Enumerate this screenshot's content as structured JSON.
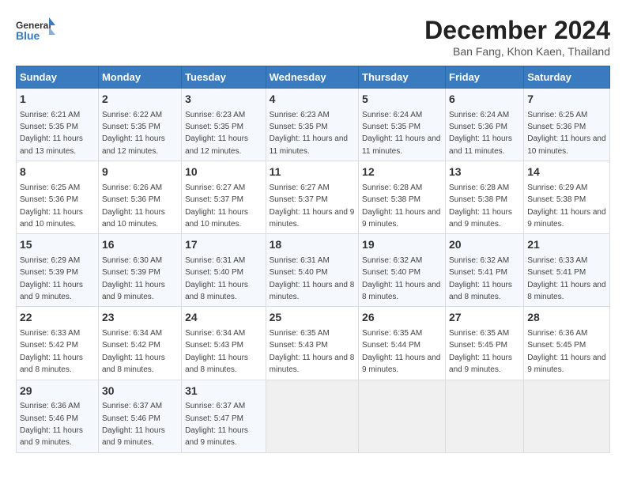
{
  "header": {
    "logo_line1": "General",
    "logo_line2": "Blue",
    "title": "December 2024",
    "subtitle": "Ban Fang, Khon Kaen, Thailand"
  },
  "days_of_week": [
    "Sunday",
    "Monday",
    "Tuesday",
    "Wednesday",
    "Thursday",
    "Friday",
    "Saturday"
  ],
  "weeks": [
    [
      {
        "day": "1",
        "rise": "6:21 AM",
        "set": "5:35 PM",
        "daylight": "11 hours and 13 minutes"
      },
      {
        "day": "2",
        "rise": "6:22 AM",
        "set": "5:35 PM",
        "daylight": "11 hours and 12 minutes"
      },
      {
        "day": "3",
        "rise": "6:23 AM",
        "set": "5:35 PM",
        "daylight": "11 hours and 12 minutes"
      },
      {
        "day": "4",
        "rise": "6:23 AM",
        "set": "5:35 PM",
        "daylight": "11 hours and 11 minutes"
      },
      {
        "day": "5",
        "rise": "6:24 AM",
        "set": "5:35 PM",
        "daylight": "11 hours and 11 minutes"
      },
      {
        "day": "6",
        "rise": "6:24 AM",
        "set": "5:36 PM",
        "daylight": "11 hours and 11 minutes"
      },
      {
        "day": "7",
        "rise": "6:25 AM",
        "set": "5:36 PM",
        "daylight": "11 hours and 10 minutes"
      }
    ],
    [
      {
        "day": "8",
        "rise": "6:25 AM",
        "set": "5:36 PM",
        "daylight": "11 hours and 10 minutes"
      },
      {
        "day": "9",
        "rise": "6:26 AM",
        "set": "5:36 PM",
        "daylight": "11 hours and 10 minutes"
      },
      {
        "day": "10",
        "rise": "6:27 AM",
        "set": "5:37 PM",
        "daylight": "11 hours and 10 minutes"
      },
      {
        "day": "11",
        "rise": "6:27 AM",
        "set": "5:37 PM",
        "daylight": "11 hours and 9 minutes"
      },
      {
        "day": "12",
        "rise": "6:28 AM",
        "set": "5:38 PM",
        "daylight": "11 hours and 9 minutes"
      },
      {
        "day": "13",
        "rise": "6:28 AM",
        "set": "5:38 PM",
        "daylight": "11 hours and 9 minutes"
      },
      {
        "day": "14",
        "rise": "6:29 AM",
        "set": "5:38 PM",
        "daylight": "11 hours and 9 minutes"
      }
    ],
    [
      {
        "day": "15",
        "rise": "6:29 AM",
        "set": "5:39 PM",
        "daylight": "11 hours and 9 minutes"
      },
      {
        "day": "16",
        "rise": "6:30 AM",
        "set": "5:39 PM",
        "daylight": "11 hours and 9 minutes"
      },
      {
        "day": "17",
        "rise": "6:31 AM",
        "set": "5:40 PM",
        "daylight": "11 hours and 8 minutes"
      },
      {
        "day": "18",
        "rise": "6:31 AM",
        "set": "5:40 PM",
        "daylight": "11 hours and 8 minutes"
      },
      {
        "day": "19",
        "rise": "6:32 AM",
        "set": "5:40 PM",
        "daylight": "11 hours and 8 minutes"
      },
      {
        "day": "20",
        "rise": "6:32 AM",
        "set": "5:41 PM",
        "daylight": "11 hours and 8 minutes"
      },
      {
        "day": "21",
        "rise": "6:33 AM",
        "set": "5:41 PM",
        "daylight": "11 hours and 8 minutes"
      }
    ],
    [
      {
        "day": "22",
        "rise": "6:33 AM",
        "set": "5:42 PM",
        "daylight": "11 hours and 8 minutes"
      },
      {
        "day": "23",
        "rise": "6:34 AM",
        "set": "5:42 PM",
        "daylight": "11 hours and 8 minutes"
      },
      {
        "day": "24",
        "rise": "6:34 AM",
        "set": "5:43 PM",
        "daylight": "11 hours and 8 minutes"
      },
      {
        "day": "25",
        "rise": "6:35 AM",
        "set": "5:43 PM",
        "daylight": "11 hours and 8 minutes"
      },
      {
        "day": "26",
        "rise": "6:35 AM",
        "set": "5:44 PM",
        "daylight": "11 hours and 9 minutes"
      },
      {
        "day": "27",
        "rise": "6:35 AM",
        "set": "5:45 PM",
        "daylight": "11 hours and 9 minutes"
      },
      {
        "day": "28",
        "rise": "6:36 AM",
        "set": "5:45 PM",
        "daylight": "11 hours and 9 minutes"
      }
    ],
    [
      {
        "day": "29",
        "rise": "6:36 AM",
        "set": "5:46 PM",
        "daylight": "11 hours and 9 minutes"
      },
      {
        "day": "30",
        "rise": "6:37 AM",
        "set": "5:46 PM",
        "daylight": "11 hours and 9 minutes"
      },
      {
        "day": "31",
        "rise": "6:37 AM",
        "set": "5:47 PM",
        "daylight": "11 hours and 9 minutes"
      },
      null,
      null,
      null,
      null
    ]
  ]
}
